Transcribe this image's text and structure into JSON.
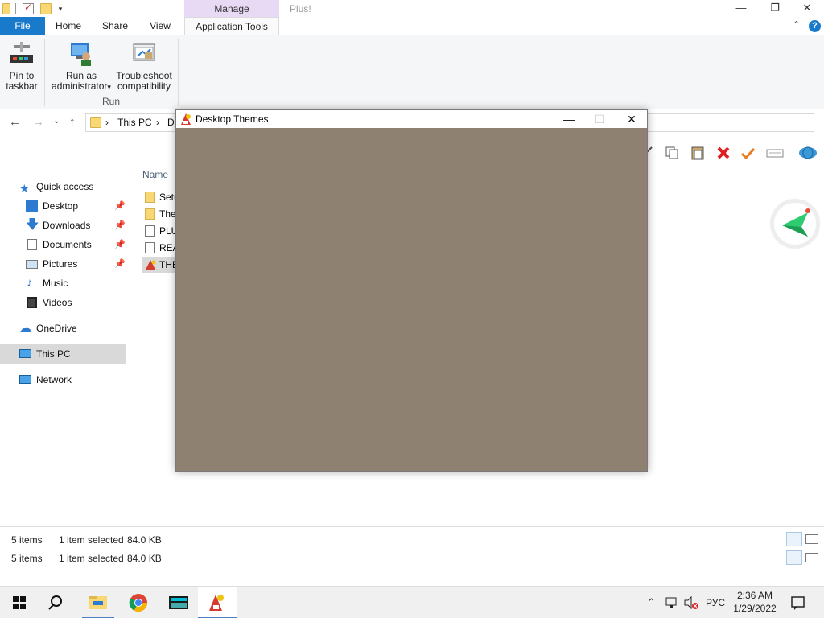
{
  "explorer": {
    "qat": [
      "folder-icon",
      "properties-icon",
      "new-folder-icon",
      "customize-qat-icon"
    ],
    "contextual_group": "Manage",
    "window_title": "Plus!",
    "tabs": {
      "file": "File",
      "home": "Home",
      "share": "Share",
      "view": "View",
      "application_tools": "Application Tools"
    },
    "ribbon": {
      "pin_label_1": "Pin to",
      "pin_label_2": "taskbar",
      "run_admin_1": "Run as",
      "run_admin_2": "administrator",
      "run_admin_arrow": "▾",
      "troubleshoot_1": "Troubleshoot",
      "troubleshoot_2": "compatibility",
      "group_run": "Run"
    },
    "address": {
      "segment_1": "This PC",
      "segment_2": "Do",
      "separator": "›"
    },
    "navpane": {
      "quick_access": "Quick access",
      "desktop": "Desktop",
      "downloads": "Downloads",
      "documents": "Documents",
      "pictures": "Pictures",
      "music": "Music",
      "videos": "Videos",
      "onedrive": "OneDrive",
      "this_pc": "This PC",
      "network": "Network"
    },
    "file_list": {
      "column_name": "Name",
      "items": [
        {
          "label": "Setu",
          "icon": "folder-icon"
        },
        {
          "label": "Ther",
          "icon": "folder-icon"
        },
        {
          "label": "PLU",
          "icon": "settings-file-icon"
        },
        {
          "label": "REA",
          "icon": "text-file-icon"
        },
        {
          "label": "THE",
          "icon": "themes-app-icon"
        }
      ]
    },
    "status": {
      "items_count": "5 items",
      "selected": "1 item selected",
      "size": "84.0 KB"
    }
  },
  "dialog": {
    "title": "Desktop Themes",
    "body_color": "#8e8172"
  },
  "taskbar": {
    "language": "РУС",
    "time": "2:36 AM",
    "date": "1/29/2022"
  },
  "colors": {
    "file_tab": "#1979ca",
    "manage_tab": "#e8d9f5",
    "dialog_body": "#8e8172",
    "selection": "#d9d9d9"
  }
}
